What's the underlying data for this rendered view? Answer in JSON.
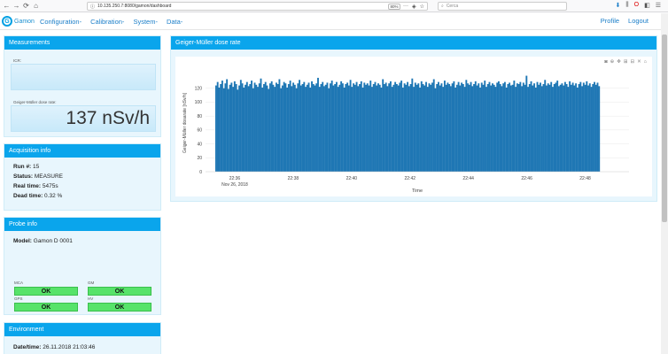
{
  "browser": {
    "url": "10.135.250.7:8080/gamon/dashboard",
    "zoom": "80%",
    "search_placeholder": "Cerca"
  },
  "navbar": {
    "logo_text": "Gamon",
    "menu": [
      "Configuration-",
      "Calibration-",
      "System-",
      "Data-"
    ],
    "profile": "Profile",
    "logout": "Logout"
  },
  "measurements": {
    "title": "Measurements",
    "icr_label": "ICR:",
    "icr_value": "",
    "dose_label": "Geiger-Müller dose rate:",
    "dose_value": "137 nSv/h"
  },
  "acquisition": {
    "title": "Acquisition info",
    "run_label": "Run #:",
    "run_value": "15",
    "status_label": "Status:",
    "status_value": "MEASURE",
    "real_label": "Real time:",
    "real_value": "5475s",
    "dead_label": "Dead time:",
    "dead_value": "0.32 %"
  },
  "probe": {
    "title": "Probe info",
    "model_label": "Model:",
    "model_value": "Gamon D 0001",
    "statuses": [
      {
        "label": "MCA",
        "value": "OK"
      },
      {
        "label": "GM",
        "value": "OK"
      },
      {
        "label": "GPS",
        "value": "OK"
      },
      {
        "label": "HV",
        "value": "OK"
      }
    ]
  },
  "environment": {
    "title": "Environment",
    "datetime_label": "Date/time:",
    "datetime_value": "26.11.2018 21:03:46"
  },
  "chart_panel": {
    "title": "Geiger-Müller dose rate",
    "modebar": [
      "camera-icon",
      "zoom-icon",
      "pan-icon",
      "zoom-in-icon",
      "zoom-out-icon",
      "autoscale-icon",
      "reset-icon"
    ]
  },
  "chart_data": {
    "type": "bar",
    "title": "",
    "xlabel": "Time",
    "ylabel": "Geiger-Müller dosarate [nSv/h]",
    "ylim": [
      0,
      140
    ],
    "yticks": [
      0,
      20,
      40,
      60,
      80,
      100,
      120
    ],
    "xticks": [
      "22:36",
      "22:38",
      "22:40",
      "22:42",
      "22:44",
      "22:46",
      "22:48"
    ],
    "xtick_sub": "Nov 26, 2018",
    "xrange": [
      "22:35:00",
      "22:49:30"
    ],
    "x_start": "22:35:20",
    "x_end": "22:48:30",
    "color": "#1f77b4",
    "values": [
      124,
      129,
      121,
      126,
      131,
      120,
      127,
      133,
      119,
      125,
      128,
      122,
      130,
      126,
      118,
      124,
      132,
      127,
      121,
      125,
      129,
      123,
      126,
      131,
      120,
      128,
      125,
      122,
      127,
      134,
      121,
      126,
      129,
      124,
      119,
      127,
      130,
      125,
      122,
      128,
      126,
      133,
      120,
      124,
      129,
      127,
      121,
      126,
      131,
      123,
      128,
      125,
      120,
      127,
      132,
      124,
      126,
      129,
      122,
      125,
      128,
      121,
      130,
      126,
      124,
      127,
      135,
      122,
      126,
      129,
      123,
      125,
      128,
      120,
      127,
      131,
      124,
      126,
      129,
      122,
      125,
      130,
      127,
      121,
      126,
      128,
      124,
      132,
      122,
      127,
      125,
      129,
      123,
      126,
      130,
      121,
      128,
      125,
      127,
      124,
      131,
      122,
      126,
      129,
      124,
      127,
      125,
      121,
      133,
      126,
      128,
      123,
      127,
      130,
      122,
      125,
      129,
      126,
      124,
      128,
      131,
      121,
      127,
      125,
      129,
      123,
      126,
      134,
      122,
      128,
      125,
      127,
      121,
      130,
      126,
      124,
      129,
      122,
      127,
      125,
      128,
      133,
      120,
      126,
      129,
      124,
      127,
      122,
      131,
      125,
      128,
      126,
      123,
      127,
      130,
      121,
      125,
      129,
      124,
      128,
      126,
      122,
      132,
      127,
      125,
      129,
      123,
      126,
      130,
      124,
      127,
      121,
      128,
      125,
      131,
      122,
      126,
      129,
      124,
      127,
      125,
      122,
      128,
      130,
      126,
      123,
      127,
      129,
      121,
      126,
      128,
      124,
      125,
      131,
      122,
      127,
      126,
      129,
      123,
      128,
      125,
      138,
      122,
      126,
      130,
      124,
      127,
      121,
      129,
      125,
      128,
      123,
      126,
      132,
      124,
      127,
      125,
      129,
      122,
      126,
      128,
      131,
      123,
      125,
      127,
      124,
      129,
      126,
      122,
      130,
      125,
      128,
      124,
      127,
      121,
      126,
      129,
      123,
      128,
      125,
      130,
      124,
      127,
      122,
      126,
      129,
      125,
      128,
      123
    ]
  }
}
